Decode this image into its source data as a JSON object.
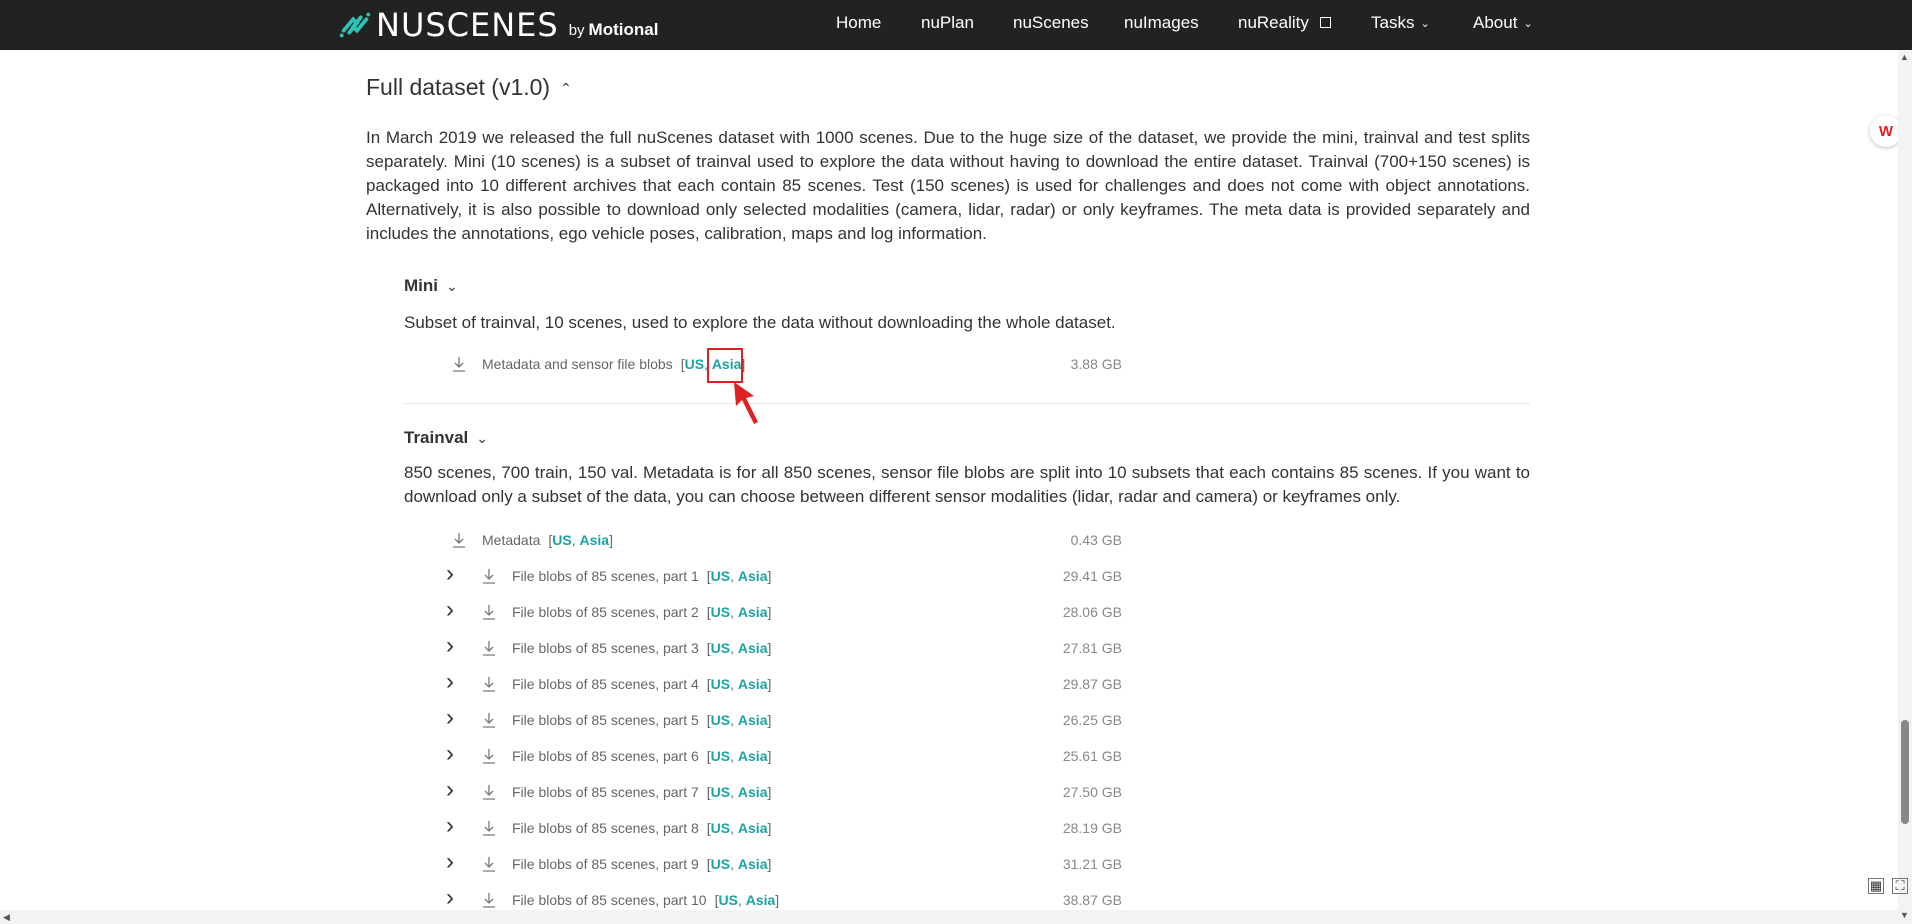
{
  "nav": {
    "brand": "NUSCENES",
    "by": "by",
    "motional": "Motional",
    "items": [
      {
        "label": "Home"
      },
      {
        "label": "nuPlan"
      },
      {
        "label": "nuScenes"
      },
      {
        "label": "nuImages"
      },
      {
        "label": "nuReality"
      },
      {
        "label": "Tasks"
      },
      {
        "label": "About"
      }
    ]
  },
  "section": {
    "title": "Full dataset (v1.0)",
    "intro": "In March 2019 we released the full nuScenes dataset with 1000 scenes. Due to the huge size of the dataset, we provide the mini, trainval and test splits separately. Mini (10 scenes) is a subset of trainval used to explore the data without having to download the entire dataset. Trainval (700+150 scenes) is packaged into 10 different archives that each contain 85 scenes. Test (150 scenes) is used for challenges and does not come with object annotations. Alternatively, it is also possible to download only selected modalities (camera, lidar, radar) or only keyframes. The meta data is provided separately and includes the annotations, ego vehicle poses, calibration, maps and log information."
  },
  "mini": {
    "title": "Mini",
    "description": "Subset of trainval, 10 scenes, used to explore the data without downloading the whole dataset.",
    "file": {
      "label": "Metadata and sensor file blobs",
      "us": "US",
      "asia": "Asia",
      "size": "3.88 GB"
    }
  },
  "trainval": {
    "title": "Trainval",
    "description": "850 scenes, 700 train, 150 val. Metadata is for all 850 scenes, sensor file blobs are split into 10 subsets that each contains 85 scenes. If you want to download only a subset of the data, you can choose between different sensor modalities (lidar, radar and camera) or keyframes only.",
    "metadata": {
      "label": "Metadata",
      "us": "US",
      "asia": "Asia",
      "size": "0.43 GB"
    },
    "parts": [
      {
        "label": "File blobs of 85 scenes, part 1",
        "us": "US",
        "asia": "Asia",
        "size": "29.41 GB"
      },
      {
        "label": "File blobs of 85 scenes, part 2",
        "us": "US",
        "asia": "Asia",
        "size": "28.06 GB"
      },
      {
        "label": "File blobs of 85 scenes, part 3",
        "us": "US",
        "asia": "Asia",
        "size": "27.81 GB"
      },
      {
        "label": "File blobs of 85 scenes, part 4",
        "us": "US",
        "asia": "Asia",
        "size": "29.87 GB"
      },
      {
        "label": "File blobs of 85 scenes, part 5",
        "us": "US",
        "asia": "Asia",
        "size": "26.25 GB"
      },
      {
        "label": "File blobs of 85 scenes, part 6",
        "us": "US",
        "asia": "Asia",
        "size": "25.61 GB"
      },
      {
        "label": "File blobs of 85 scenes, part 7",
        "us": "US",
        "asia": "Asia",
        "size": "27.50 GB"
      },
      {
        "label": "File blobs of 85 scenes, part 8",
        "us": "US",
        "asia": "Asia",
        "size": "28.19 GB"
      },
      {
        "label": "File blobs of 85 scenes, part 9",
        "us": "US",
        "asia": "Asia",
        "size": "31.21 GB"
      },
      {
        "label": "File blobs of 85 scenes, part 10",
        "us": "US",
        "asia": "Asia",
        "size": "38.87 GB"
      }
    ]
  },
  "colors": {
    "accent": "#1aa3a3",
    "navbar": "#222222",
    "highlight": "#e02020"
  }
}
